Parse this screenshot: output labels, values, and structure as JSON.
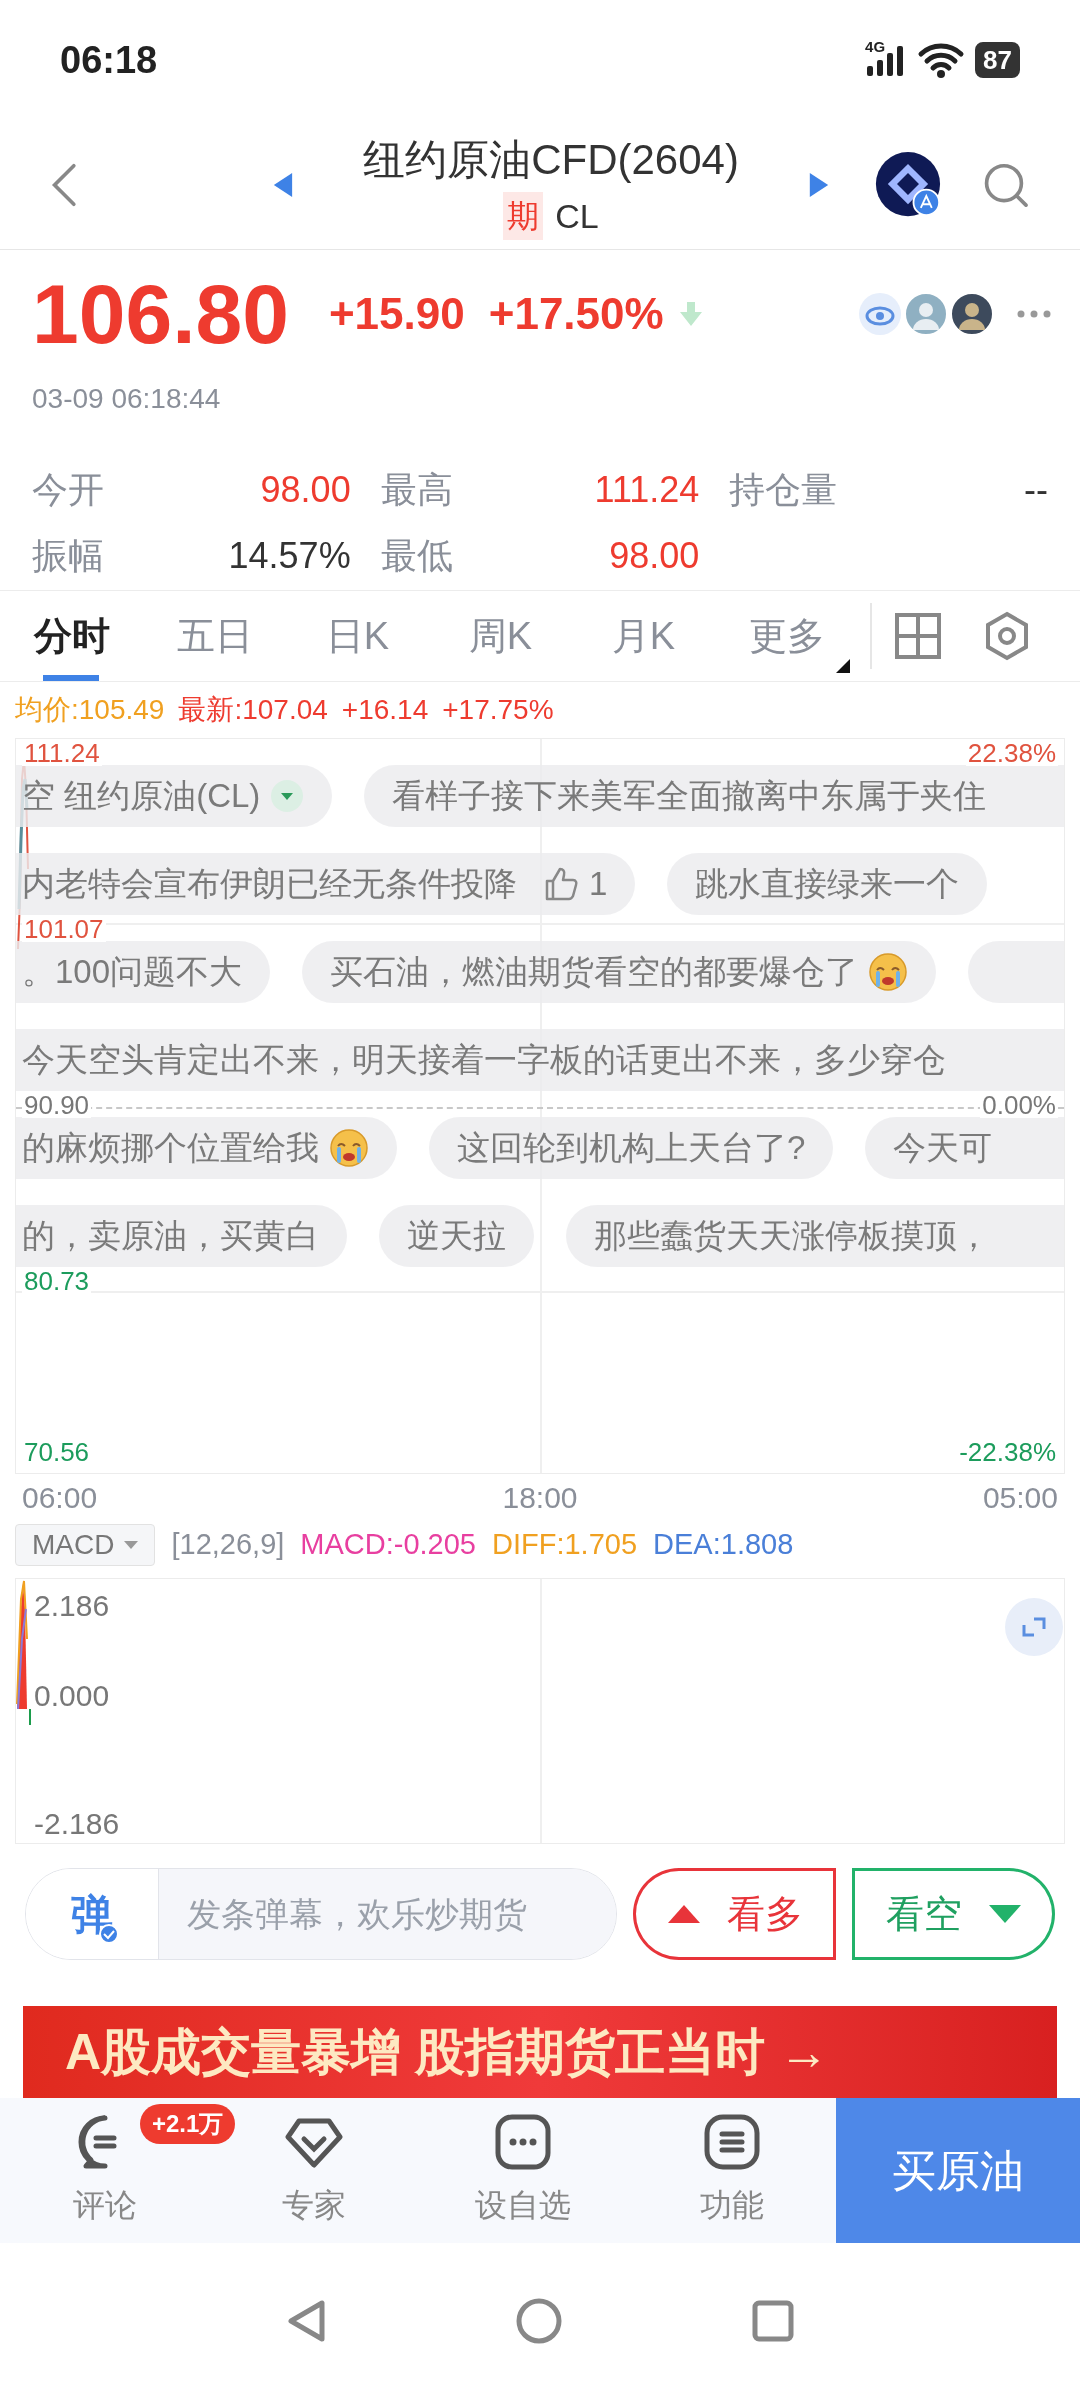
{
  "status_bar": {
    "time": "06:18",
    "network": "4G",
    "battery": "87"
  },
  "header": {
    "title": "纽约原油CFD(2604)",
    "badge": "期",
    "code": "CL"
  },
  "quote": {
    "price": "106.80",
    "change": "+15.90",
    "change_pct": "+17.50%",
    "timestamp": "03-09 06:18:44"
  },
  "stats": [
    {
      "label": "今开",
      "value": "98.00",
      "color": "#ee3b2f"
    },
    {
      "label": "最高",
      "value": "111.24",
      "color": "#ee3b2f"
    },
    {
      "label": "持仓量",
      "value": "--",
      "color": "#333333"
    },
    {
      "label": "振幅",
      "value": "14.57%",
      "color": "#333333"
    },
    {
      "label": "最低",
      "value": "98.00",
      "color": "#ee3b2f"
    }
  ],
  "tabs": [
    {
      "label": "分时",
      "selected": true,
      "kind": "tab"
    },
    {
      "label": "五日",
      "selected": false,
      "kind": "tab"
    },
    {
      "label": "日K",
      "selected": false,
      "kind": "tab"
    },
    {
      "label": "周K",
      "selected": false,
      "kind": "tab"
    },
    {
      "label": "月K",
      "selected": false,
      "kind": "tab"
    },
    {
      "label": "更多",
      "selected": false,
      "kind": "menu"
    }
  ],
  "chart_info": [
    {
      "text": "均价:105.49",
      "kind": "avg"
    },
    {
      "text": "最新:107.04",
      "kind": "up"
    },
    {
      "text": "+16.14",
      "kind": "up"
    },
    {
      "text": "+17.75%",
      "kind": "up"
    }
  ],
  "price_chart": {
    "left_labels": [
      {
        "text": "111.24",
        "color": "#e0533f"
      },
      {
        "text": "101.07",
        "color": "#e0533f"
      },
      {
        "text": "90.90",
        "color": "#777777"
      },
      {
        "text": "80.73",
        "color": "#1c9c5c"
      },
      {
        "text": "70.56",
        "color": "#1c9c5c"
      }
    ],
    "right_labels": [
      {
        "text": "22.38%",
        "color": "#e0533f"
      },
      {
        "text": "0.00%",
        "color": "#777777"
      },
      {
        "text": "-22.38%",
        "color": "#1c9c5c"
      }
    ],
    "time_labels": [
      "06:00",
      "18:00",
      "05:00"
    ]
  },
  "danmaku": [
    [
      {
        "text": "空 纽约原油(CL)",
        "cut_left": true,
        "kind": "dropdown"
      },
      {
        "text": "看样子接下来美军全面撤离中东属于夹住",
        "cut_right": true
      }
    ],
    [
      {
        "text": "内老特会宣布伊朗已经无条件投降",
        "cut_left": true,
        "kind": "likes",
        "likes": "1"
      },
      {
        "text": "跳水直接绿来一个"
      }
    ],
    [
      {
        "text": "。100问题不大",
        "cut_left": true
      },
      {
        "text": "买石油，燃油期货看空的都要爆仓了",
        "kind": "emoji"
      },
      {
        "cut_right": true
      }
    ],
    [
      {
        "text": "今天空头肯定出不来，明天接着一字板的话更出不来，多少穿仓",
        "cut_left": true,
        "cut_right": true
      }
    ],
    [
      {
        "text": "的麻烦挪个位置给我",
        "cut_left": true,
        "kind": "emoji"
      },
      {
        "text": "这回轮到机构上天台了?"
      },
      {
        "text": "今天可",
        "cut_right": true
      }
    ],
    [
      {
        "text": "的，卖原油，买黄白",
        "cut_left": true
      },
      {
        "text": "逆天拉"
      },
      {
        "text": "那些蠢货天天涨停板摸顶，",
        "cut_right": true
      }
    ]
  ],
  "indicator": {
    "name": "MACD",
    "params": "[12,26,9]",
    "values": [
      {
        "text": "MACD:-0.205",
        "kind": "macd"
      },
      {
        "text": "DIFF:1.705",
        "kind": "diff"
      },
      {
        "text": "DEA:1.808",
        "kind": "dea"
      }
    ]
  },
  "macd_chart": {
    "labels": [
      "2.186",
      "0.000",
      "-2.186"
    ]
  },
  "comment_box": {
    "logo": "弹",
    "placeholder": "发条弹幕，欢乐炒期货"
  },
  "vote_buttons": [
    {
      "label": "看多",
      "kind": "bull"
    },
    {
      "label": "看空",
      "kind": "bear"
    }
  ],
  "banner": {
    "text": "A股成交量暴增 股指期货正当时 →"
  },
  "bottom_nav": [
    {
      "label": "评论",
      "badge": "+2.1万"
    },
    {
      "label": "专家"
    },
    {
      "label": "设自选"
    },
    {
      "label": "功能"
    }
  ],
  "buy_button": {
    "label": "买原油"
  }
}
